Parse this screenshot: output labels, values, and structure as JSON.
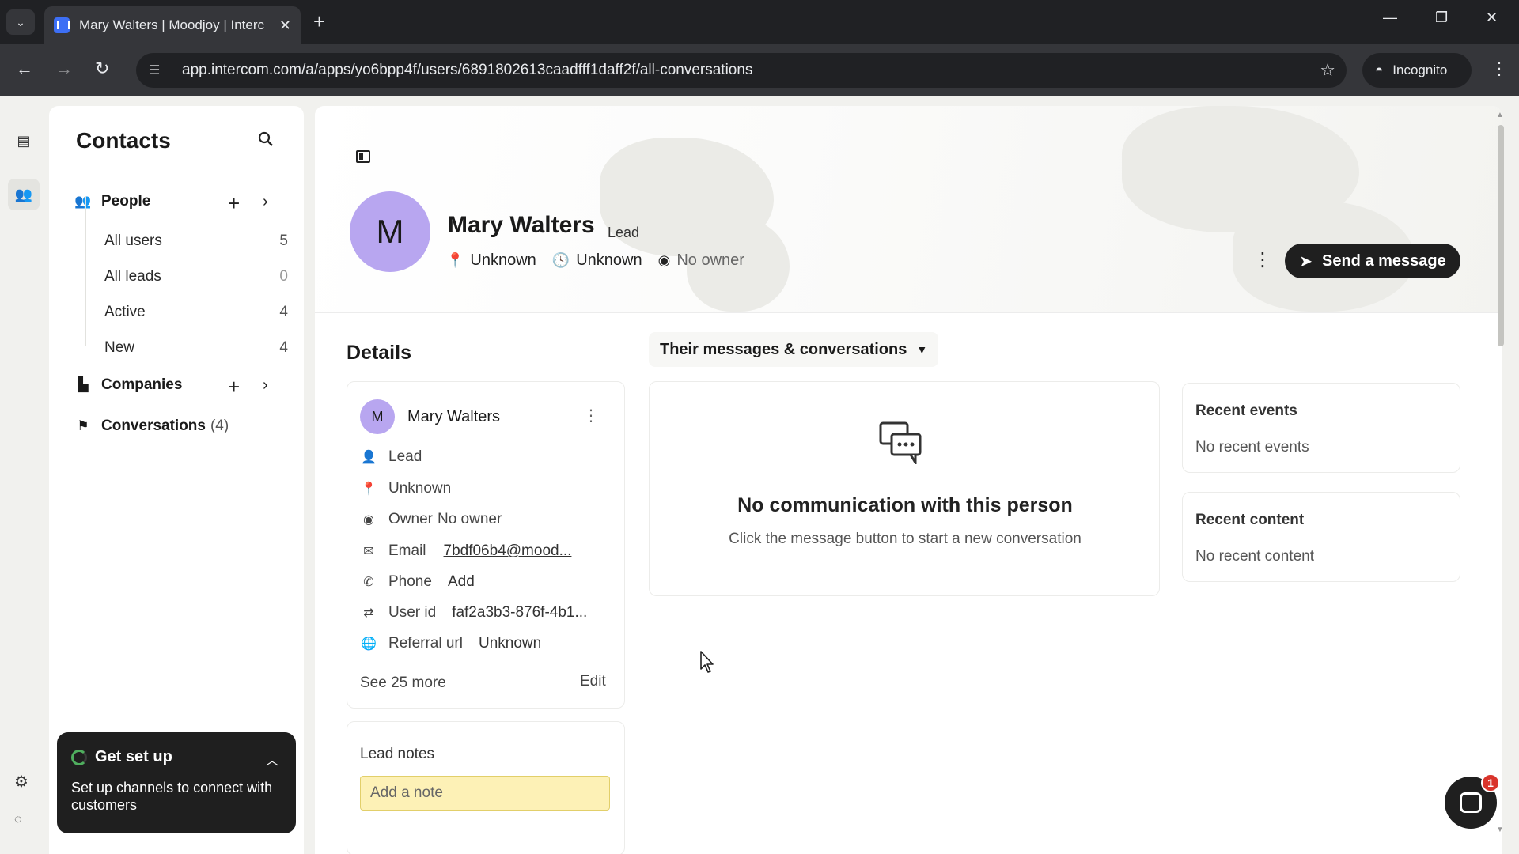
{
  "browser": {
    "tab_title": "Mary Walters | Moodjoy | Interc",
    "url": "app.intercom.com/a/apps/yo6bpp4f/users/6891802613caadfff1daff2f/all-conversations",
    "incognito_label": "Incognito"
  },
  "sidebar": {
    "title": "Contacts",
    "people_label": "People",
    "people_items": [
      {
        "label": "All users",
        "count": "5"
      },
      {
        "label": "All leads",
        "count": "0"
      },
      {
        "label": "Active",
        "count": "4"
      },
      {
        "label": "New",
        "count": "4"
      }
    ],
    "companies_label": "Companies",
    "conversations_label": "Conversations",
    "conversations_count": "(4)"
  },
  "get_set_up": {
    "title": "Get set up",
    "body": "Set up channels to connect with customers"
  },
  "profile": {
    "initial": "M",
    "name": "Mary Walters",
    "badge": "Lead",
    "location": "Unknown",
    "time": "Unknown",
    "owner": "No owner",
    "send_message_label": "Send a message"
  },
  "details": {
    "section_title": "Details",
    "card_name": "Mary Walters",
    "initial": "M",
    "type": "Lead",
    "location": "Unknown",
    "owner_label": "Owner",
    "owner_value": "No owner",
    "email_label": "Email",
    "email_value": "7bdf06b4@mood...",
    "phone_label": "Phone",
    "phone_value": "Add",
    "userid_label": "User id",
    "userid_value": "faf2a3b3-876f-4b1...",
    "referral_label": "Referral url",
    "referral_value": "Unknown",
    "see_more": "See 25 more",
    "edit": "Edit"
  },
  "lead_notes": {
    "title": "Lead notes",
    "placeholder": "Add a note"
  },
  "conversations": {
    "filter_label": "Their messages & conversations",
    "empty_title": "No communication with this person",
    "empty_sub": "Click the message button to start a new conversation"
  },
  "recent_events": {
    "title": "Recent events",
    "empty": "No recent events"
  },
  "recent_content": {
    "title": "Recent content",
    "empty": "No recent content"
  },
  "messenger": {
    "badge_count": "1"
  }
}
